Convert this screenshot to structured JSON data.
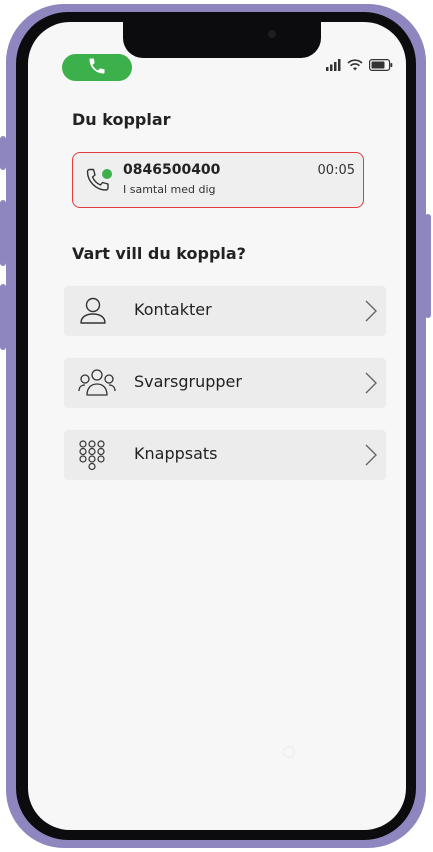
{
  "status_bar": {
    "call_indicator_icon": "phone-icon",
    "signal_icon": "cellular-signal-icon",
    "wifi_icon": "wifi-icon",
    "battery_icon": "battery-icon"
  },
  "transfer": {
    "heading": "Du kopplar",
    "active_call": {
      "number": "0846500400",
      "status": "I samtal med dig",
      "duration": "00:05",
      "icon": "phone-with-green-dot-icon",
      "border_color": "#e23c3c"
    }
  },
  "destination": {
    "heading": "Vart vill du koppla?",
    "items": [
      {
        "label": "Kontakter",
        "icon": "person-icon"
      },
      {
        "label": "Svarsgrupper",
        "icon": "group-icon"
      },
      {
        "label": "Knappsats",
        "icon": "keypad-icon"
      }
    ]
  },
  "colors": {
    "call_green": "#3cb04a",
    "frame": "#8e86bf",
    "alert_red": "#e23c3c"
  }
}
